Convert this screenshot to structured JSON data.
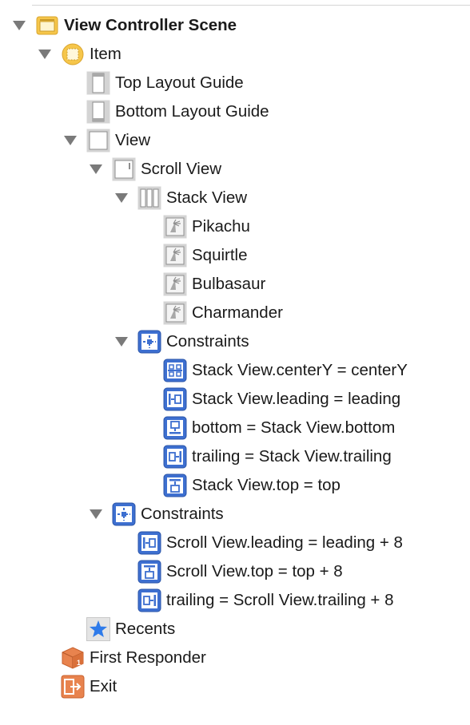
{
  "outline": {
    "scene_title": "View Controller Scene",
    "item": "Item",
    "top_layout_guide": "Top Layout Guide",
    "bottom_layout_guide": "Bottom Layout Guide",
    "view": "View",
    "scroll_view": "Scroll View",
    "stack_view": "Stack View",
    "images": [
      "Pikachu",
      "Squirtle",
      "Bulbasaur",
      "Charmander"
    ],
    "stack_constraints_label": "Constraints",
    "stack_constraints": [
      "Stack View.centerY = centerY",
      "Stack View.leading = leading",
      "bottom = Stack View.bottom",
      "trailing = Stack View.trailing",
      "Stack View.top = top"
    ],
    "view_constraints_label": "Constraints",
    "view_constraints": [
      "Scroll View.leading = leading + 8",
      "Scroll View.top = top + 8",
      "trailing = Scroll View.trailing + 8"
    ],
    "recents": "Recents",
    "first_responder": "First Responder",
    "exit": "Exit"
  },
  "colors": {
    "constraint_blue": "#3d6fd0",
    "scene_yellow": "#f6c64a",
    "responder_orange": "#e8834e",
    "star_blue": "#2f7bea"
  }
}
